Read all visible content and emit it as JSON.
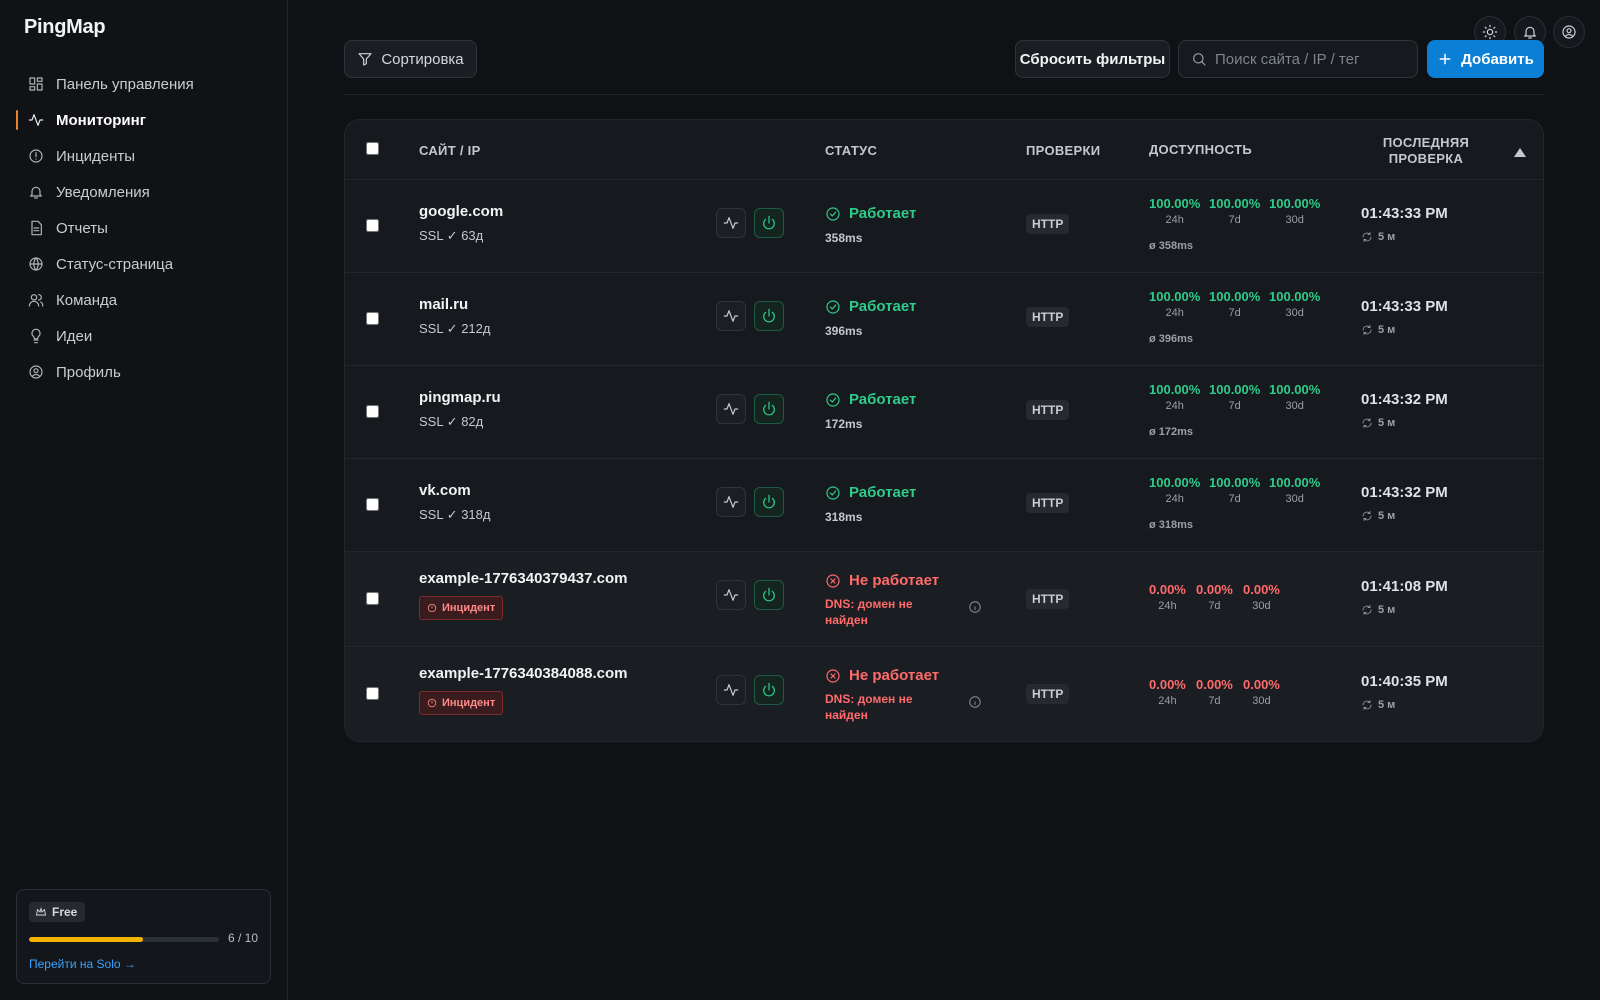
{
  "app": {
    "logo": "PingMap"
  },
  "sidebar": {
    "items": [
      {
        "label": "Панель управления",
        "icon": "dashboard-icon"
      },
      {
        "label": "Мониторинг",
        "icon": "activity-icon",
        "active": true
      },
      {
        "label": "Инциденты",
        "icon": "alert-circle-icon"
      },
      {
        "label": "Уведомления",
        "icon": "bell-icon"
      },
      {
        "label": "Отчеты",
        "icon": "file-text-icon"
      },
      {
        "label": "Статус-страница",
        "icon": "globe-icon"
      },
      {
        "label": "Команда",
        "icon": "users-icon"
      },
      {
        "label": "Идеи",
        "icon": "lightbulb-icon"
      },
      {
        "label": "Профиль",
        "icon": "user-circle-icon"
      }
    ],
    "plan": {
      "name": "Free",
      "used": 6,
      "limit": 10,
      "count_label": "6 / 10",
      "upgrade_link": "Перейти на Solo →"
    }
  },
  "toolbar": {
    "sort_label": "Сортировка",
    "reset_label": "Сбросить фильтры",
    "search_placeholder": "Поиск сайта / IP / тег",
    "add_label": "Добавить"
  },
  "table": {
    "headers": {
      "site": "САЙТ / IP",
      "status": "СТАТУС",
      "checks": "ПРОВЕРКИ",
      "availability": "ДОСТУПНОСТЬ",
      "last_check_1": "ПОСЛЕДНЯЯ",
      "last_check_2": "ПРОВЕРКА"
    },
    "rows": [
      {
        "site": "google.com",
        "ssl": "SSL ✓ 63д",
        "state": "up",
        "status": "Работает",
        "ms": "358ms",
        "check": "HTTP",
        "a24": "100.00%",
        "a7": "100.00%",
        "a30": "100.00%",
        "p24": "24h",
        "p7": "7d",
        "p30": "30d",
        "avg": "ø 358ms",
        "time": "01:43:33 PM",
        "interval": "5 м"
      },
      {
        "site": "mail.ru",
        "ssl": "SSL ✓ 212д",
        "state": "up",
        "status": "Работает",
        "ms": "396ms",
        "check": "HTTP",
        "a24": "100.00%",
        "a7": "100.00%",
        "a30": "100.00%",
        "p24": "24h",
        "p7": "7d",
        "p30": "30d",
        "avg": "ø 396ms",
        "time": "01:43:33 PM",
        "interval": "5 м"
      },
      {
        "site": "pingmap.ru",
        "ssl": "SSL ✓ 82д",
        "state": "up",
        "status": "Работает",
        "ms": "172ms",
        "check": "HTTP",
        "a24": "100.00%",
        "a7": "100.00%",
        "a30": "100.00%",
        "p24": "24h",
        "p7": "7d",
        "p30": "30d",
        "avg": "ø 172ms",
        "time": "01:43:32 PM",
        "interval": "5 м"
      },
      {
        "site": "vk.com",
        "ssl": "SSL ✓ 318д",
        "state": "up",
        "status": "Работает",
        "ms": "318ms",
        "check": "HTTP",
        "a24": "100.00%",
        "a7": "100.00%",
        "a30": "100.00%",
        "p24": "24h",
        "p7": "7d",
        "p30": "30d",
        "avg": "ø 318ms",
        "time": "01:43:32 PM",
        "interval": "5 м"
      },
      {
        "site": "example-1776340379437.com",
        "incident": "Инцидент",
        "state": "down",
        "status": "Не работает",
        "error": "DNS: домен не найден",
        "check": "HTTP",
        "a24": "0.00%",
        "a7": "0.00%",
        "a30": "0.00%",
        "p24": "24h",
        "p7": "7d",
        "p30": "30d",
        "time": "01:41:08 PM",
        "interval": "5 м"
      },
      {
        "site": "example-1776340384088.com",
        "incident": "Инцидент",
        "state": "down",
        "status": "Не работает",
        "error": "DNS: домен не найден",
        "check": "HTTP",
        "a24": "0.00%",
        "a7": "0.00%",
        "a30": "0.00%",
        "p24": "24h",
        "p7": "7d",
        "p30": "30d",
        "time": "01:40:35 PM",
        "interval": "5 м"
      }
    ]
  },
  "colors": {
    "accent": "#0b7fd6",
    "up": "#2ecc8a",
    "down": "#ff6b6b",
    "active_marker": "#e8842a",
    "plan_bar": "#f4b400"
  }
}
